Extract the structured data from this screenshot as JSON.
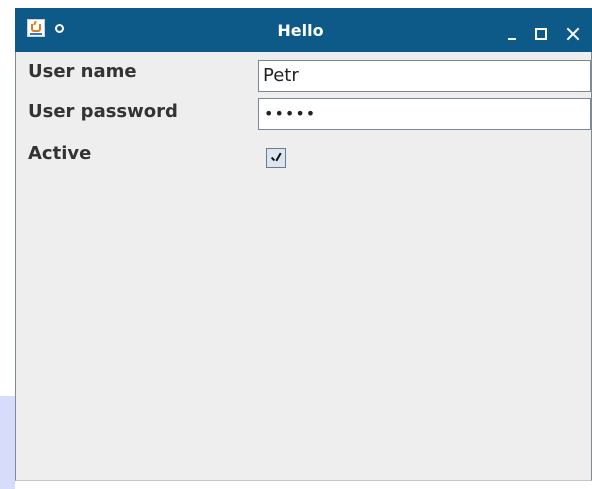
{
  "window": {
    "title": "Hello",
    "titlebar_color": "#0d5a88",
    "client_bg": "#eeeeee",
    "icons": {
      "app": "java-cup-icon",
      "menu": "window-menu-icon",
      "minimize": "minimize-icon",
      "maximize": "maximize-icon",
      "close": "close-icon"
    }
  },
  "form": {
    "username_label": "User name",
    "username_value": "Petr",
    "password_label": "User password",
    "password_display": "•••••",
    "active_label": "Active",
    "active_checked": true
  }
}
